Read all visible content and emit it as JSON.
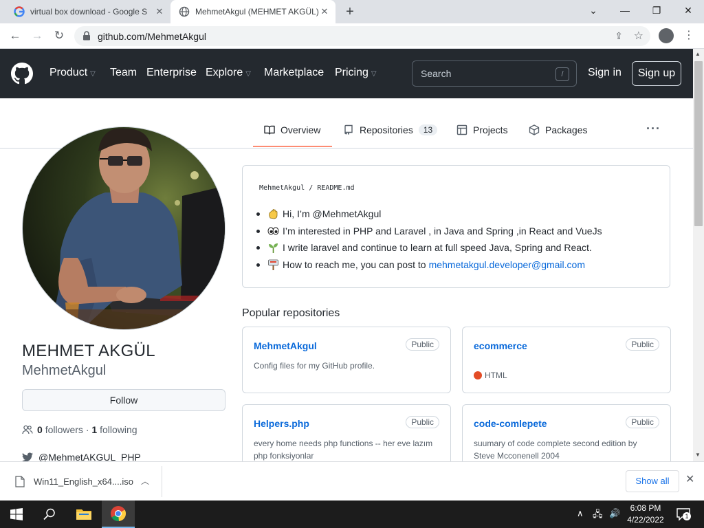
{
  "browser": {
    "tabs": [
      {
        "title": "virtual box download - Google S",
        "close": "✕"
      },
      {
        "title": "MehmetAkgul (MEHMET AKGÜL)",
        "close": "✕"
      }
    ],
    "new_tab": "+",
    "url": "github.com/MehmetAkgul",
    "window_controls": {
      "minimize": "—",
      "restore": "❐",
      "close": "✕",
      "tab_search": "⌄"
    }
  },
  "github_header": {
    "nav": [
      {
        "label": "Product",
        "caret": true
      },
      {
        "label": "Team",
        "caret": false
      },
      {
        "label": "Enterprise",
        "caret": false
      },
      {
        "label": "Explore",
        "caret": true
      },
      {
        "label": "Marketplace",
        "caret": false
      },
      {
        "label": "Pricing",
        "caret": true
      }
    ],
    "search_placeholder": "Search",
    "search_shortcut": "/",
    "sign_in": "Sign in",
    "sign_up": "Sign up"
  },
  "profile_tabs": {
    "overview": "Overview",
    "repositories": "Repositories",
    "repositories_count": "13",
    "projects": "Projects",
    "packages": "Packages",
    "more": "···"
  },
  "profile": {
    "full_name": "MEHMET AKGÜL",
    "username": "MehmetAkgul",
    "follow_label": "Follow",
    "followers_count": "0",
    "followers_label": "followers",
    "separator": "·",
    "following_count": "1",
    "following_label": "following",
    "twitter": "@MehmetAKGUL_PHP"
  },
  "readme": {
    "path_owner": "MehmetAkgul",
    "path_sep": "/",
    "path_file": "README.md",
    "items": [
      {
        "emoji": "wave",
        "text": "Hi, I’m @MehmetAkgul"
      },
      {
        "emoji": "eyes",
        "text": "I’m interested in PHP and Laravel , in Java and Spring ,in React and VueJs"
      },
      {
        "emoji": "seedling",
        "text": "I write laravel and continue to learn at full speed Java, Spring and React."
      },
      {
        "emoji": "mailbox",
        "text": "How to reach me, you can post to",
        "link": "mehmetakgul.developer@gmail.com"
      }
    ]
  },
  "popular": {
    "title": "Popular repositories",
    "repos": [
      {
        "name": "MehmetAkgul",
        "badge": "Public",
        "description": "Config files for my GitHub profile.",
        "language": ""
      },
      {
        "name": "ecommerce",
        "badge": "Public",
        "description": "",
        "language": "HTML",
        "language_color": "#e34c26"
      },
      {
        "name": "Helpers.php",
        "badge": "Public",
        "description": "every home needs php functions -- her eve lazım php fonksiyonlar",
        "language": ""
      },
      {
        "name": "code-comlepete",
        "badge": "Public",
        "description": "suumary of code complete second edition by Steve Mcconenell 2004",
        "language": ""
      }
    ]
  },
  "downloads": {
    "file": "Win11_English_x64....iso",
    "show_all": "Show all"
  },
  "taskbar": {
    "time": "6:08 PM",
    "date": "4/22/2022",
    "notification_count": "1"
  }
}
